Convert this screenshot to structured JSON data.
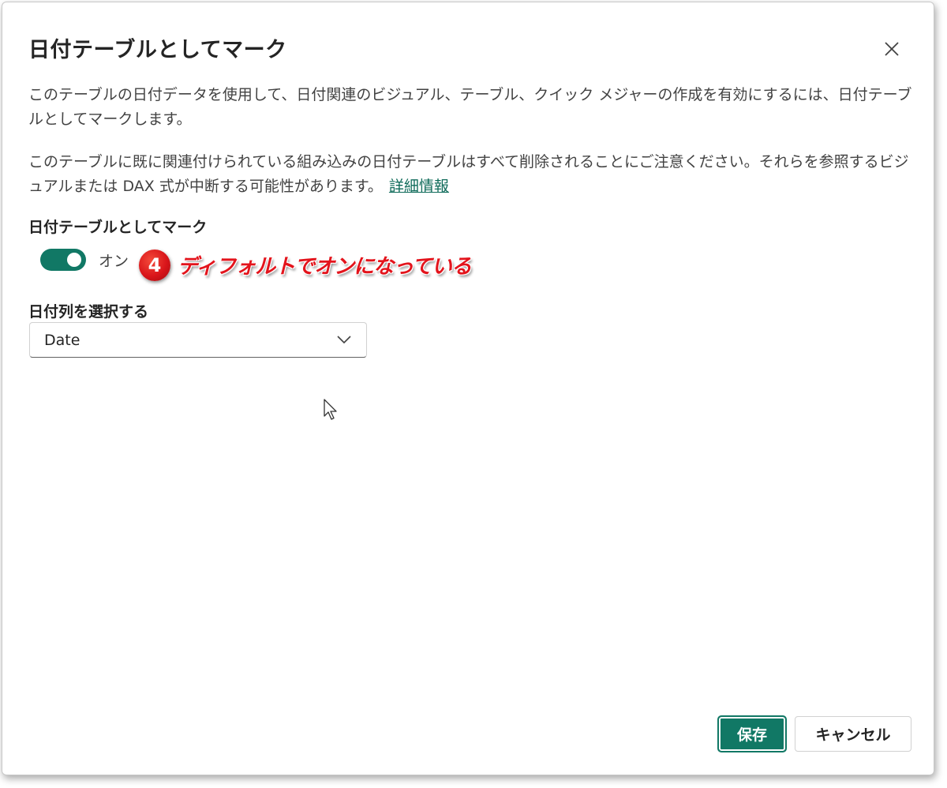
{
  "dialog": {
    "title": "日付テーブルとしてマーク",
    "close_icon": "close-icon",
    "description_1": "このテーブルの日付データを使用して、日付関連のビジュアル、テーブル、クイック メジャーの作成を有効にするには、日付テーブルとしてマークします。",
    "description_2": "このテーブルに既に関連付けられている組み込みの日付テーブルはすべて削除されることにご注意ください。それらを参照するビジュアルまたは DAX 式が中断する可能性があります。",
    "learn_more_link": "詳細情報"
  },
  "mark_toggle": {
    "label": "日付テーブルとしてマーク",
    "state_text": "オン",
    "is_on": true,
    "color": "#117865"
  },
  "annotation": {
    "step_number": "4",
    "text": "ディフォルトでオンになっている",
    "color": "#e3141c"
  },
  "date_column": {
    "label": "日付列を選択する",
    "selected_value": "Date",
    "chevron_icon": "chevron-down-icon"
  },
  "footer": {
    "save_label": "保存",
    "cancel_label": "キャンセル",
    "accent_color": "#117865"
  }
}
